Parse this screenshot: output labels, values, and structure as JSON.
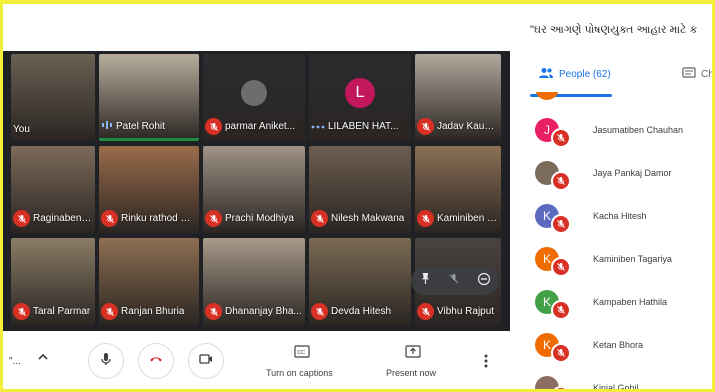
{
  "meeting_title": "\"ઘર આગણે પોષણયુક્ત આહાર માટે ક",
  "people_tab": {
    "label": "People (62)"
  },
  "chat_tab": {
    "label": "Cha"
  },
  "tiles": [
    {
      "name": "You",
      "mic": "none",
      "bg": "#6a6153"
    },
    {
      "name": "Patel Rohit",
      "mic": "speaking",
      "bg": "#b8ad9d"
    },
    {
      "name": "parmar Aniket...",
      "mic": "off",
      "bg": "#2b2c2f",
      "avatar_color": "#6d6d6d"
    },
    {
      "name": "LILABEN HAT...",
      "mic": "dots",
      "bg": "#2b2c2f",
      "avatar_letter": "L",
      "avatar_color": "#c2185b"
    },
    {
      "name": "Jadav Kaushal...",
      "mic": "off",
      "bg": "#b2a89c"
    },
    {
      "name": "Raginaben Tag...",
      "mic": "off",
      "bg": "#7d6a5a"
    },
    {
      "name": "Rinku rathod Ri...",
      "mic": "off",
      "bg": "#9b6c4b"
    },
    {
      "name": "Prachi Modhiya",
      "mic": "off",
      "bg": "#a09386"
    },
    {
      "name": "Nilesh Makwana",
      "mic": "off",
      "bg": "#6d5e50"
    },
    {
      "name": "Kaminiben Tag...",
      "mic": "off",
      "bg": "#8b6f55"
    },
    {
      "name": "Taral Parmar",
      "mic": "off",
      "bg": "#8a7d66"
    },
    {
      "name": "Ranjan Bhuria",
      "mic": "off",
      "bg": "#8e6f52"
    },
    {
      "name": "Dhananjay Bha...",
      "mic": "off",
      "bg": "#a89a8a"
    },
    {
      "name": "Devda Hitesh",
      "mic": "off",
      "bg": "#7a6a54"
    },
    {
      "name": "Vibhu Rajput",
      "mic": "off",
      "bg": "#4a4341"
    }
  ],
  "controls": {
    "more_dots": "\"...",
    "captions_label": "Turn on captions",
    "present_label": "Present now"
  },
  "people": [
    {
      "name": "Jasumatiben Chauhan",
      "letter": "J",
      "color": "#e91e63"
    },
    {
      "name": "Jaya Pankaj Damor",
      "letter": "",
      "color": "#7b6b5a"
    },
    {
      "name": "Kacha Hitesh",
      "letter": "K",
      "color": "#5c6bc0"
    },
    {
      "name": "Kaminiben Tagariya",
      "letter": "K",
      "color": "#ef6c00"
    },
    {
      "name": "Kampaben Hathila",
      "letter": "K",
      "color": "#43a047"
    },
    {
      "name": "Ketan Bhora",
      "letter": "K",
      "color": "#ef6c00"
    },
    {
      "name": "Kinjal Gohil",
      "letter": "",
      "color": "#8d6e63"
    }
  ]
}
